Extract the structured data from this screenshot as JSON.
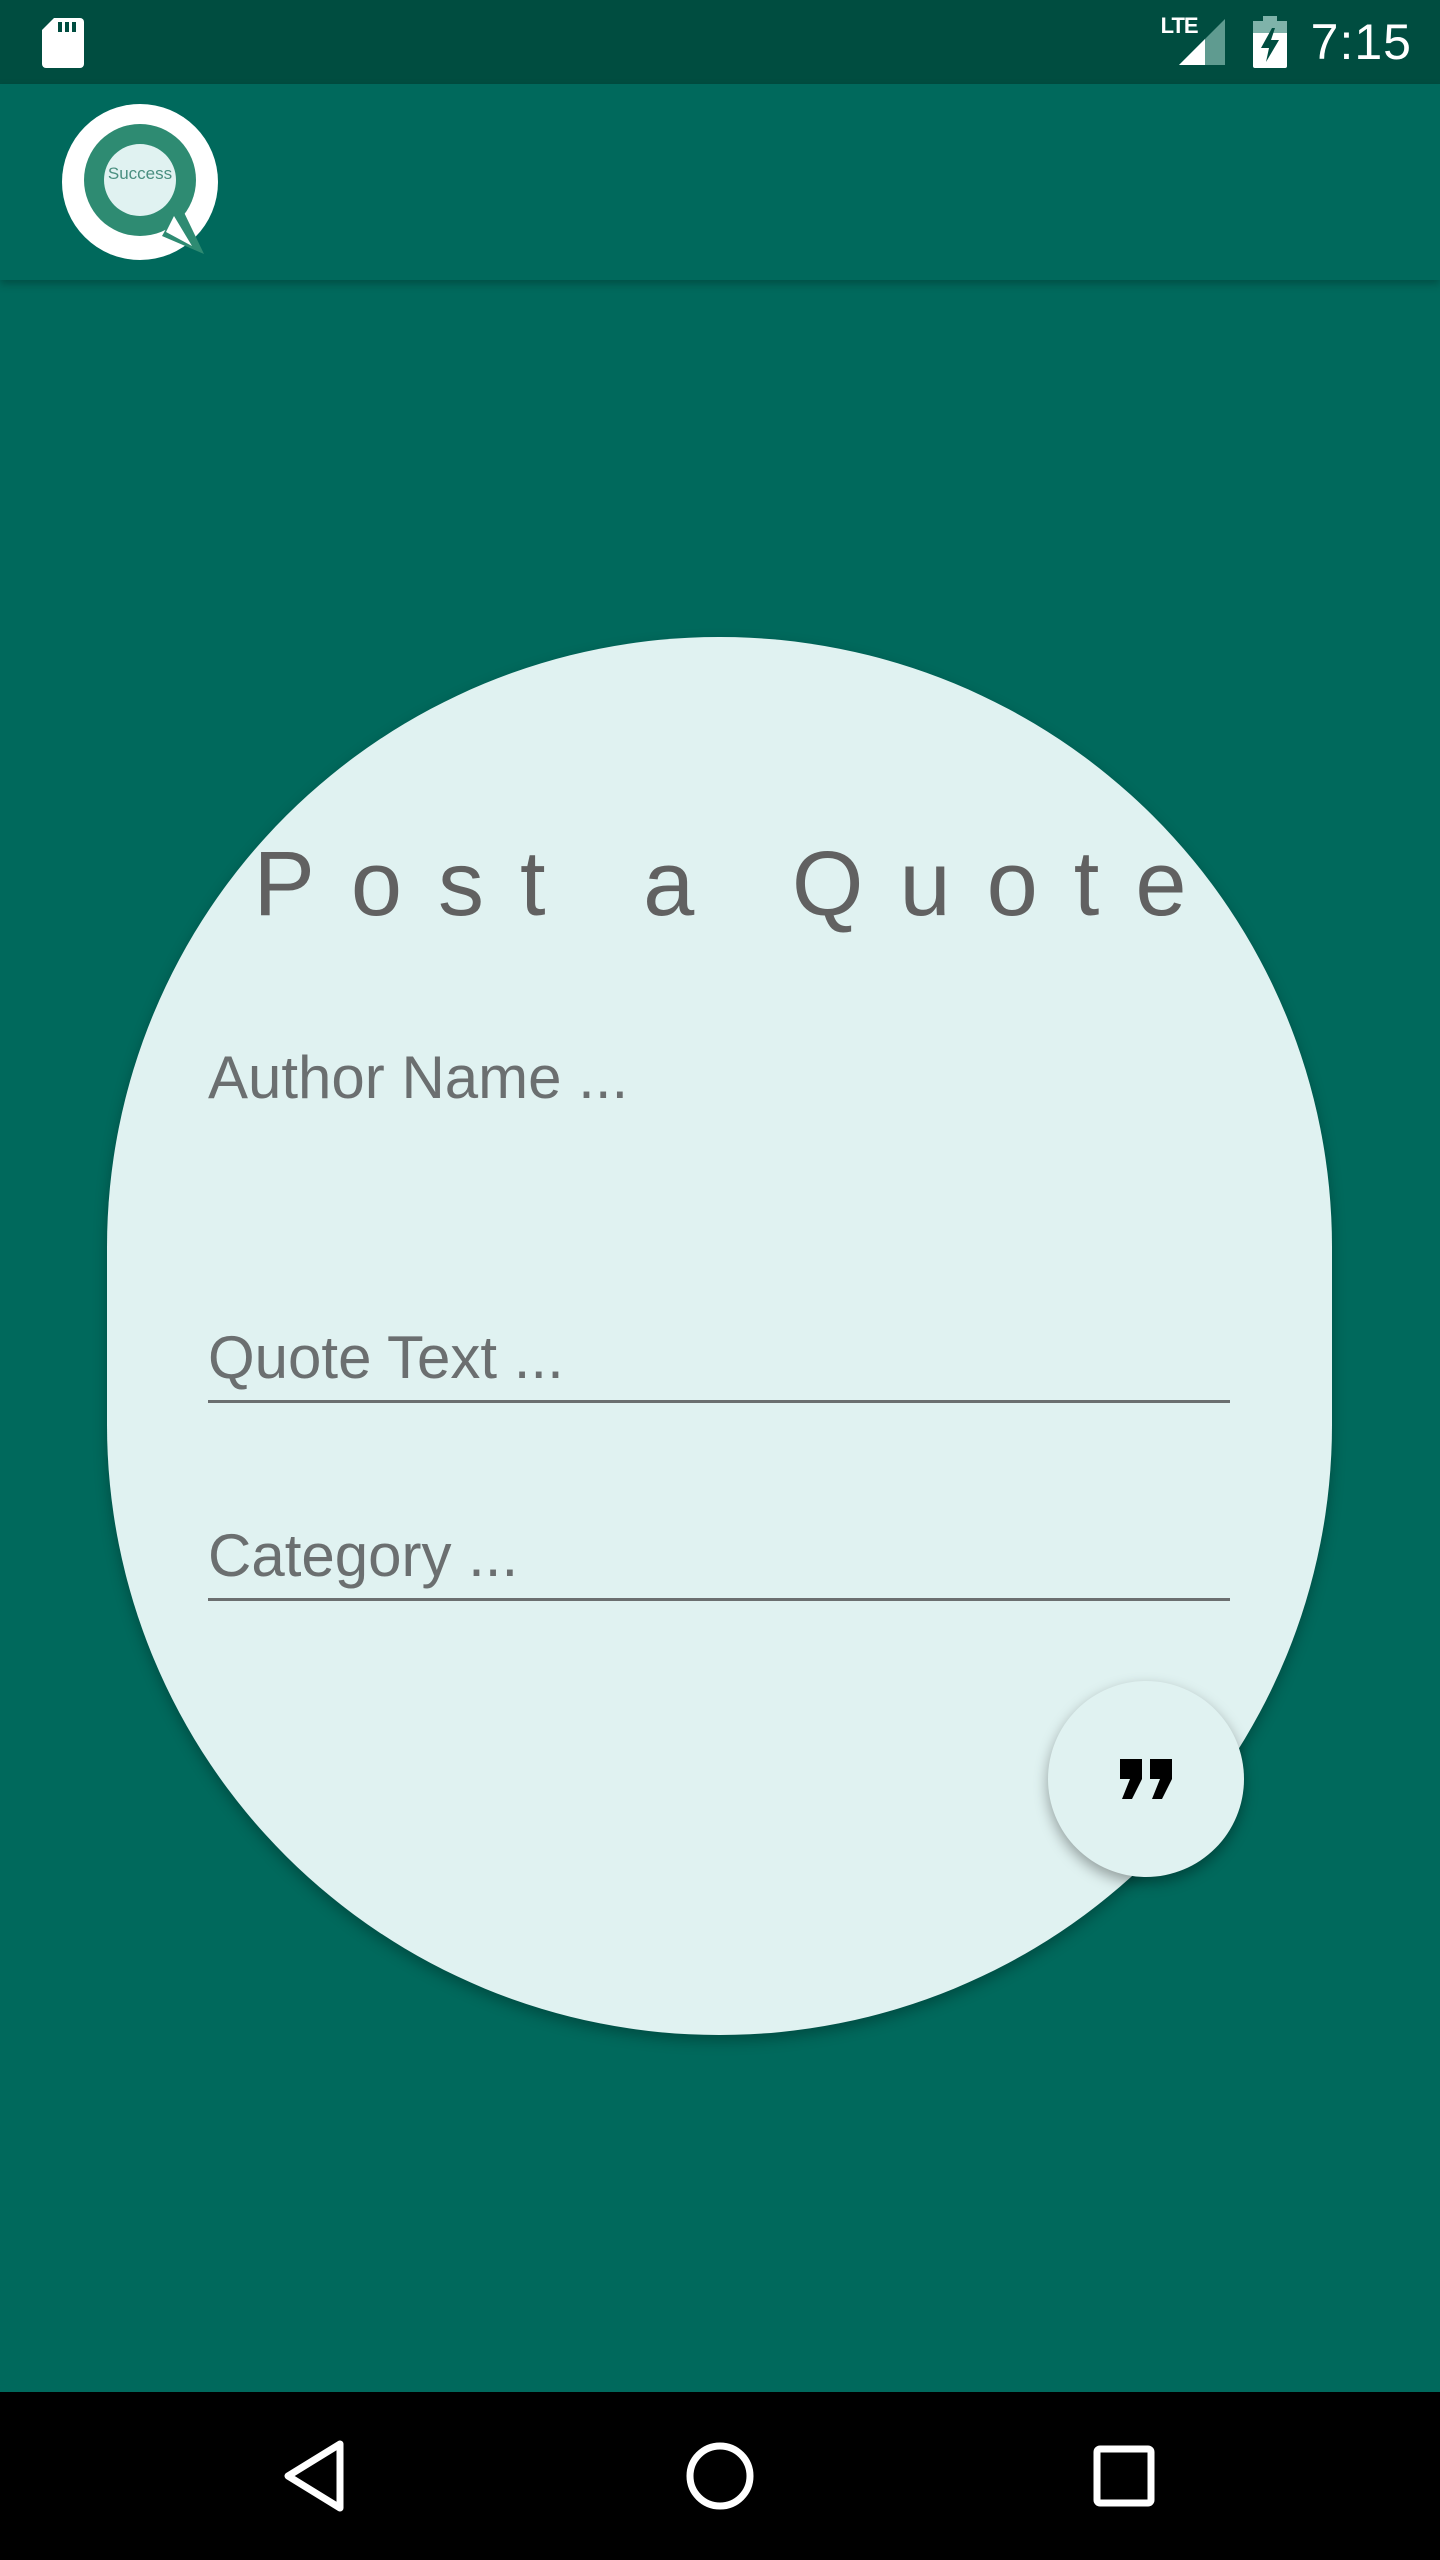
{
  "status_bar": {
    "time": "7:15",
    "network_label": "LTE",
    "icons": [
      "sd-card-icon",
      "lte-signal-icon",
      "battery-charging-icon"
    ],
    "background": "#004d40"
  },
  "app_bar": {
    "logo_text": "Success",
    "background": "#00695c"
  },
  "form": {
    "title": "Post a Quote",
    "author_placeholder": "Author Name ...",
    "quote_placeholder": "Quote Text ...",
    "category_placeholder": "Category ...",
    "submit_icon": "quote-icon",
    "card_color": "#e0f2f1"
  },
  "nav_bar": {
    "icons": [
      "back-icon",
      "home-icon",
      "recents-icon"
    ],
    "background": "#000000"
  }
}
